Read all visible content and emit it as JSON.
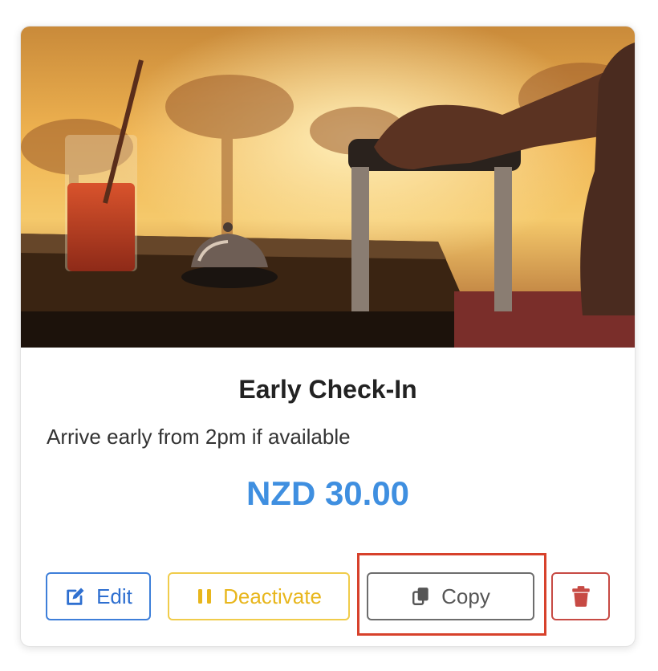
{
  "card": {
    "title": "Early Check-In",
    "description": "Arrive early from 2pm if available",
    "price": "NZD 30.00",
    "image_icon": "hotel-checkin-photo"
  },
  "actions": {
    "edit_label": "Edit",
    "deactivate_label": "Deactivate",
    "copy_label": "Copy",
    "delete_icon": "trash-icon"
  },
  "colors": {
    "price": "#3f8fe0",
    "edit": "#2e6fd0",
    "deactivate": "#e8b61c",
    "copy": "#555555",
    "delete": "#c74a44",
    "highlight": "#d7412b"
  }
}
